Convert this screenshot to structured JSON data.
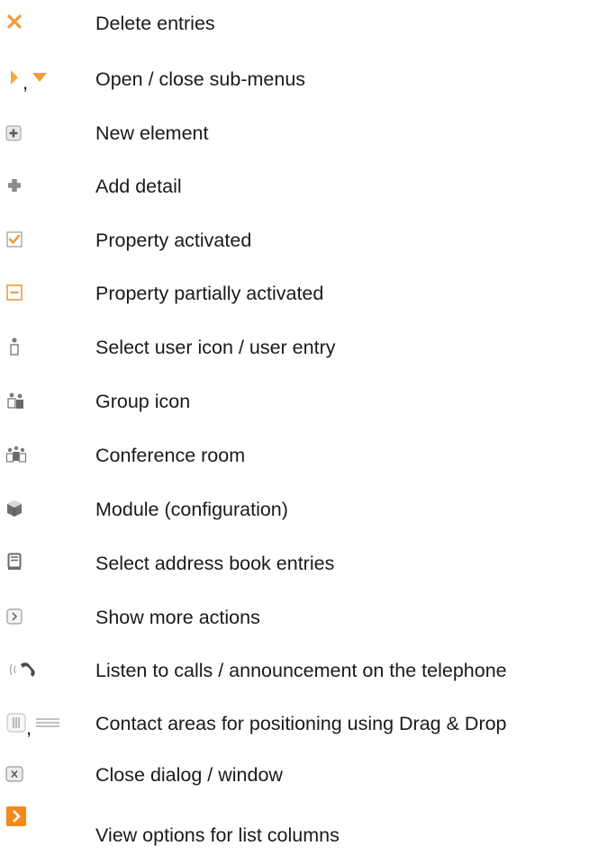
{
  "legend": {
    "items": [
      {
        "icon": "delete-x-icon",
        "label": "Delete entries"
      },
      {
        "icon": "arrow-right-icon,arrow-down-icon",
        "separator": ",",
        "label": "Open / close sub-menus"
      },
      {
        "icon": "new-element-plus-box-icon",
        "label": "New element"
      },
      {
        "icon": "add-detail-plus-icon",
        "label": "Add detail"
      },
      {
        "icon": "checkbox-checked-icon",
        "label": "Property activated"
      },
      {
        "icon": "checkbox-partial-icon",
        "label": "Property partially activated"
      },
      {
        "icon": "user-icon",
        "label": "Select user icon / user entry"
      },
      {
        "icon": "group-icon",
        "label": "Group icon"
      },
      {
        "icon": "conference-room-icon",
        "label": "Conference room"
      },
      {
        "icon": "module-cube-icon",
        "label": "Module (configuration)"
      },
      {
        "icon": "address-book-icon",
        "label": "Select address book entries"
      },
      {
        "icon": "more-actions-icon",
        "label": "Show more actions"
      },
      {
        "icon": "telephone-listen-icon",
        "label": "Listen to calls / announcement on the telephone"
      },
      {
        "icon": "drag-handle-vertical-icon,drag-handle-horizontal-icon",
        "separator": ",",
        "label": "Contact areas for positioning using Drag & Drop"
      },
      {
        "icon": "close-dialog-icon",
        "label": "Close dialog / window"
      },
      {
        "icon": "view-options-icon",
        "label": "View options for list columns"
      }
    ]
  },
  "colors": {
    "accent_orange": "#f39a3c",
    "icon_gray": "#8c8c8c",
    "text": "#1a1a1a"
  }
}
